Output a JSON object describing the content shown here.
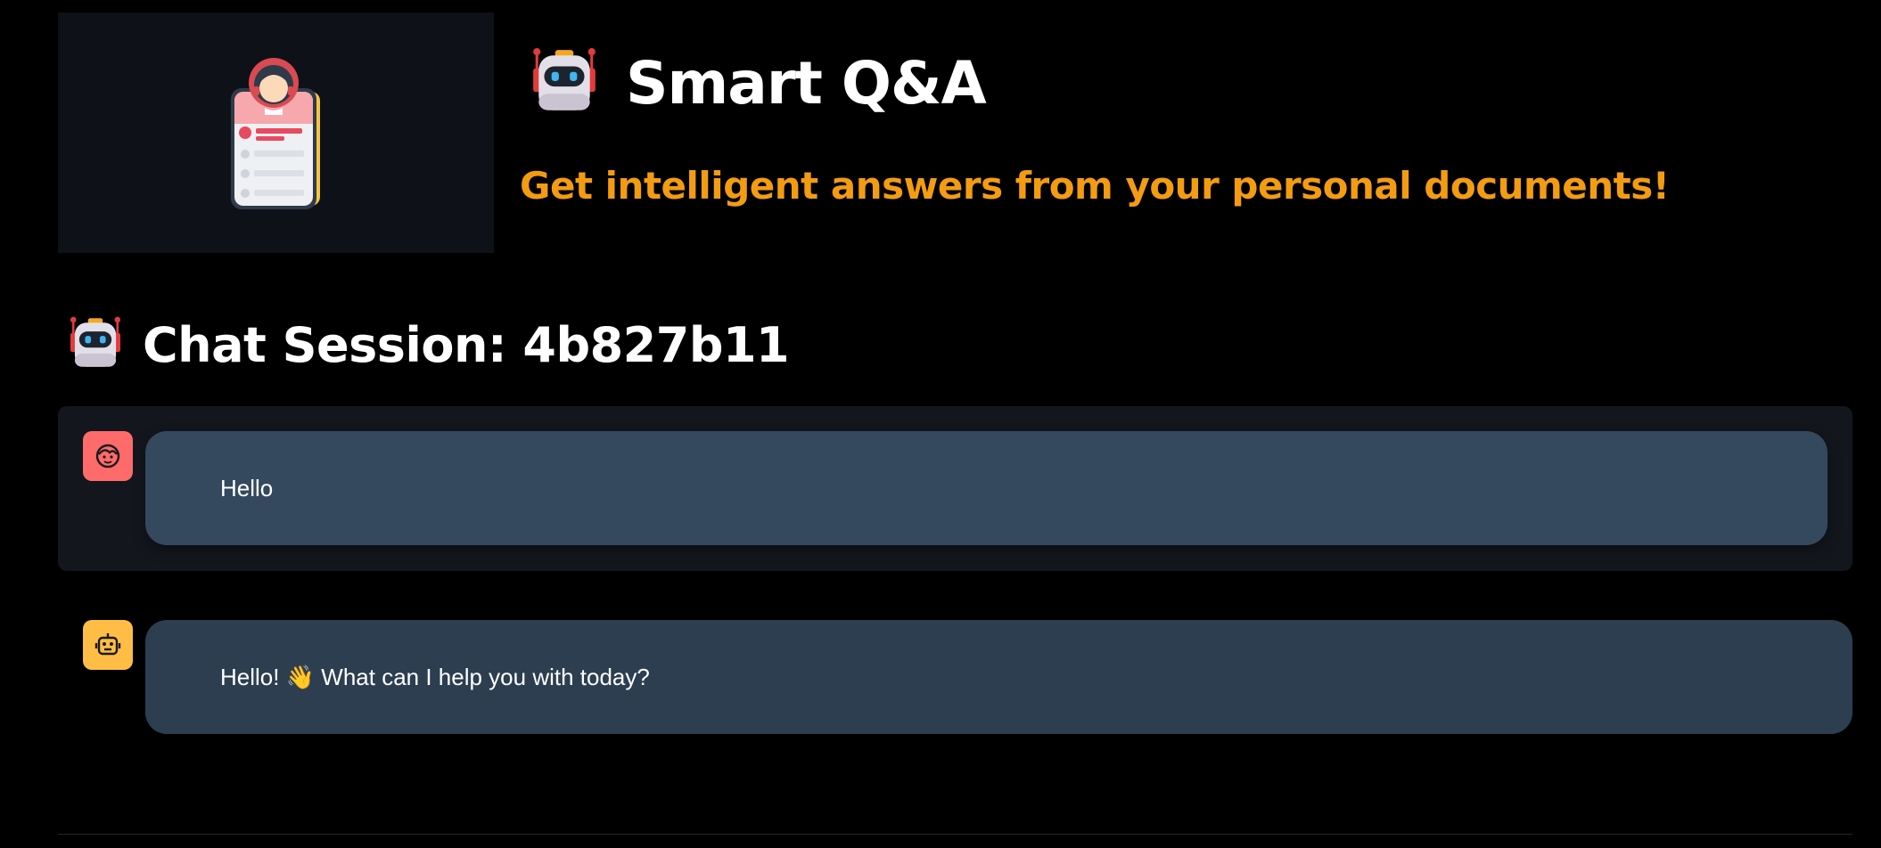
{
  "header": {
    "title": "Smart Q&A",
    "subtitle": "Get intelligent answers from your personal documents!",
    "title_icon": "robot-icon",
    "logo_icon": "support-agent-card-icon"
  },
  "session": {
    "heading": "Chat Session: 4b827b11",
    "icon": "robot-icon"
  },
  "chat": {
    "messages": [
      {
        "role": "user",
        "avatar_icon": "user-face-icon",
        "text": "Hello"
      },
      {
        "role": "assistant",
        "avatar_icon": "bot-icon",
        "text": "Hello! 👋 What can I help you with today?"
      }
    ]
  },
  "colors": {
    "background": "#000000",
    "accent": "#f39c12",
    "user_avatar": "#ff6b6b",
    "bot_avatar": "#ffbd45",
    "user_bubble": "#34495e",
    "bot_bubble": "#2c3e50"
  }
}
